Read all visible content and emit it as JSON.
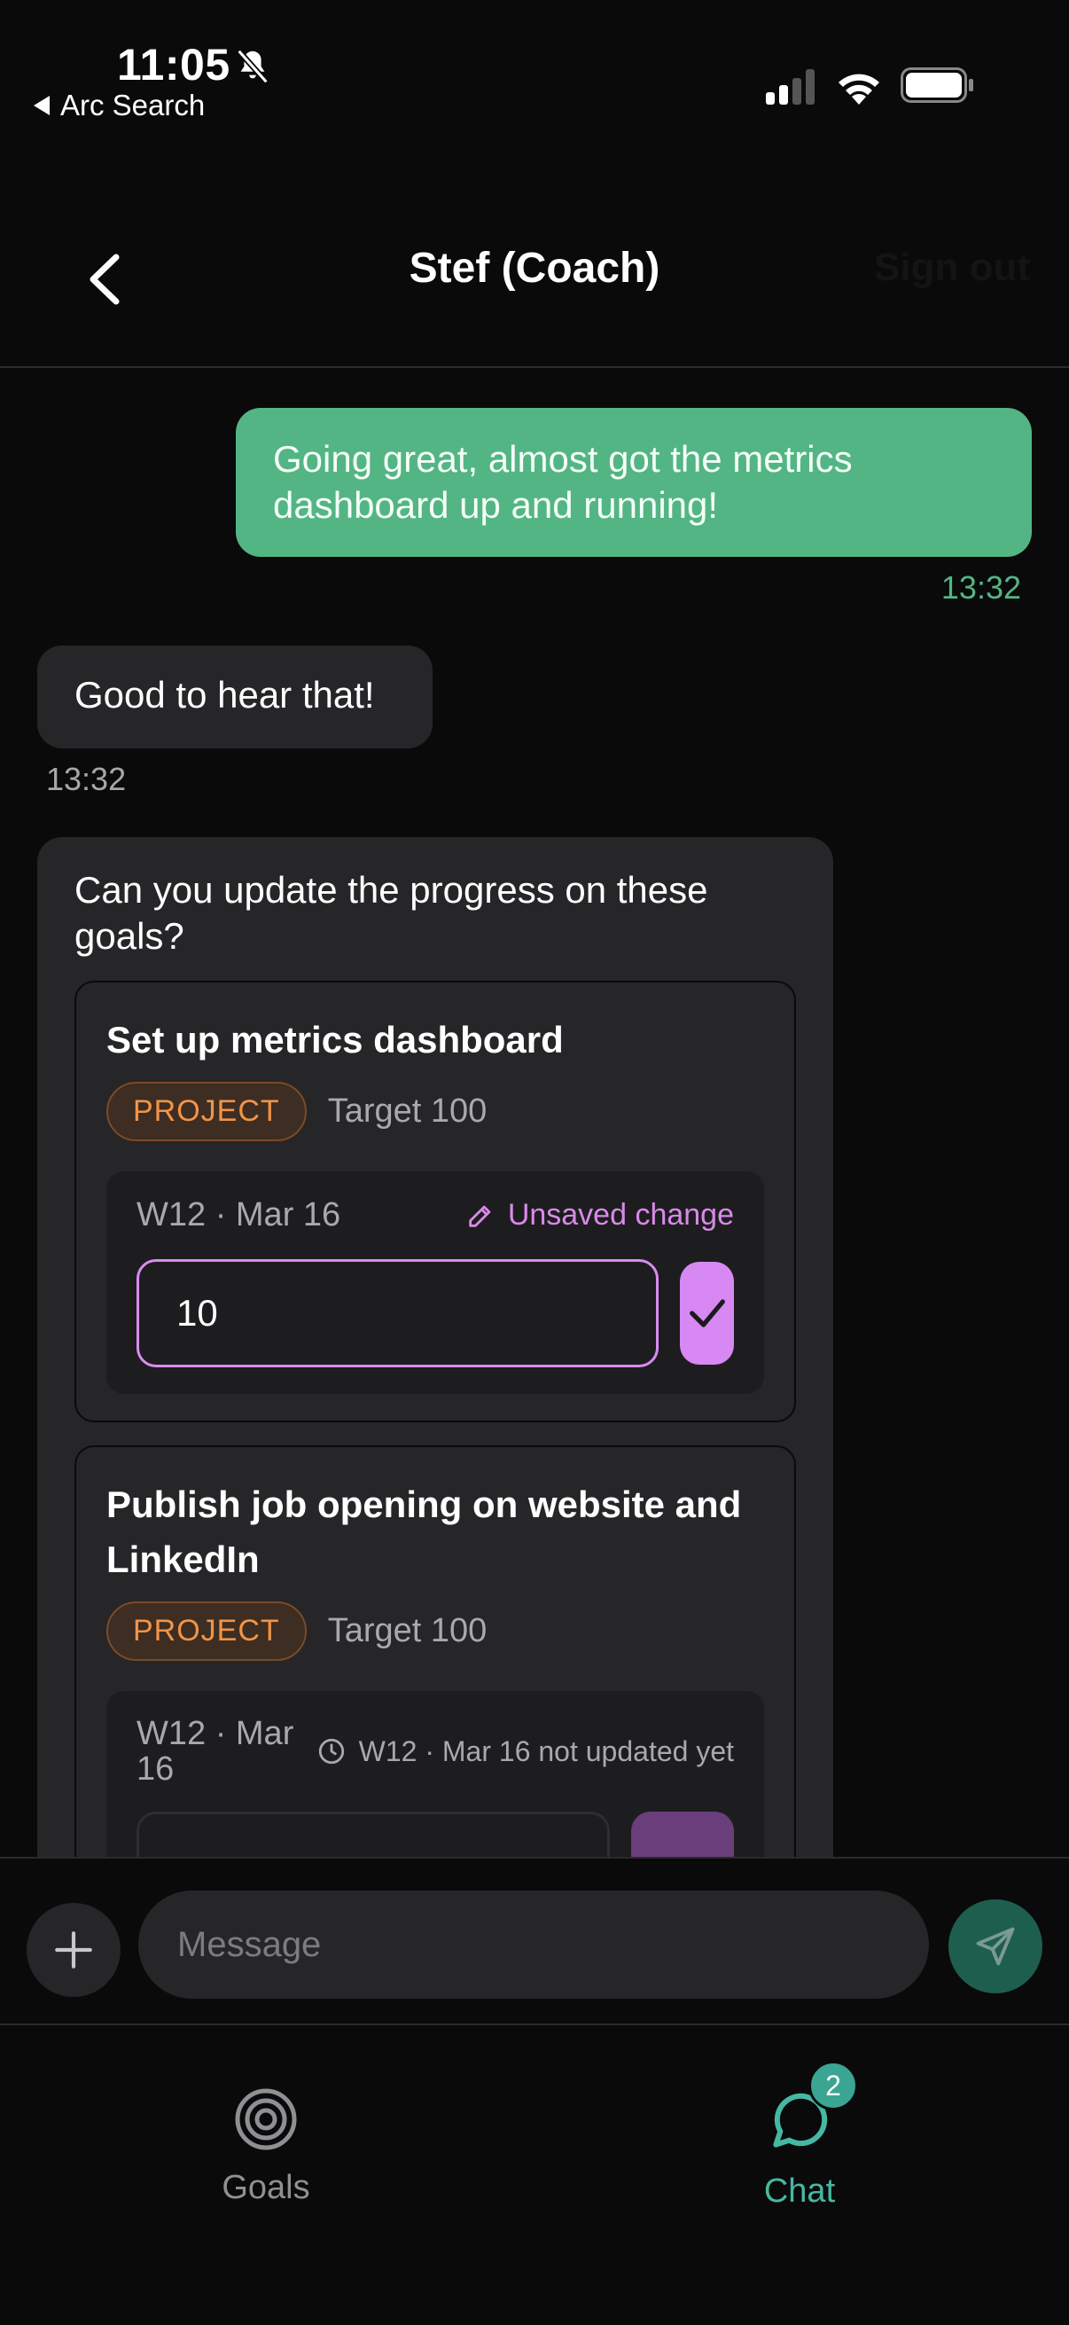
{
  "status_bar": {
    "time": "11:05",
    "back_app": "Arc Search",
    "icons": [
      "bell-slash-icon",
      "signal-icon",
      "wifi-icon",
      "battery-icon"
    ]
  },
  "header": {
    "title": "Stef (Coach)",
    "sign_out": "Sign out"
  },
  "messages": {
    "outgoing_text": "Going great, almost got the metrics dashboard up and running!",
    "outgoing_time": "13:32",
    "incoming_text": "Good to hear that!",
    "incoming_time": "13:32",
    "card_question": "Can you update the progress on these goals?"
  },
  "goals": [
    {
      "title": "Set up metrics dashboard",
      "badge": "PROJECT",
      "target": "Target 100",
      "week": "W12 · Mar 16",
      "status": "Unsaved change",
      "value": "10"
    },
    {
      "title": "Publish job opening on website and LinkedIn",
      "badge": "PROJECT",
      "target": "Target 100",
      "week": "W12 · Mar 16",
      "status": "W12 · Mar 16 not updated yet"
    }
  ],
  "composer": {
    "placeholder": "Message"
  },
  "tabs": {
    "goals": "Goals",
    "chat": "Chat",
    "chat_badge": "2"
  },
  "colors": {
    "accent_green": "#54b584",
    "accent_purple": "#d788f2",
    "badge_orange": "#f29447",
    "teal": "#45b8a3"
  }
}
